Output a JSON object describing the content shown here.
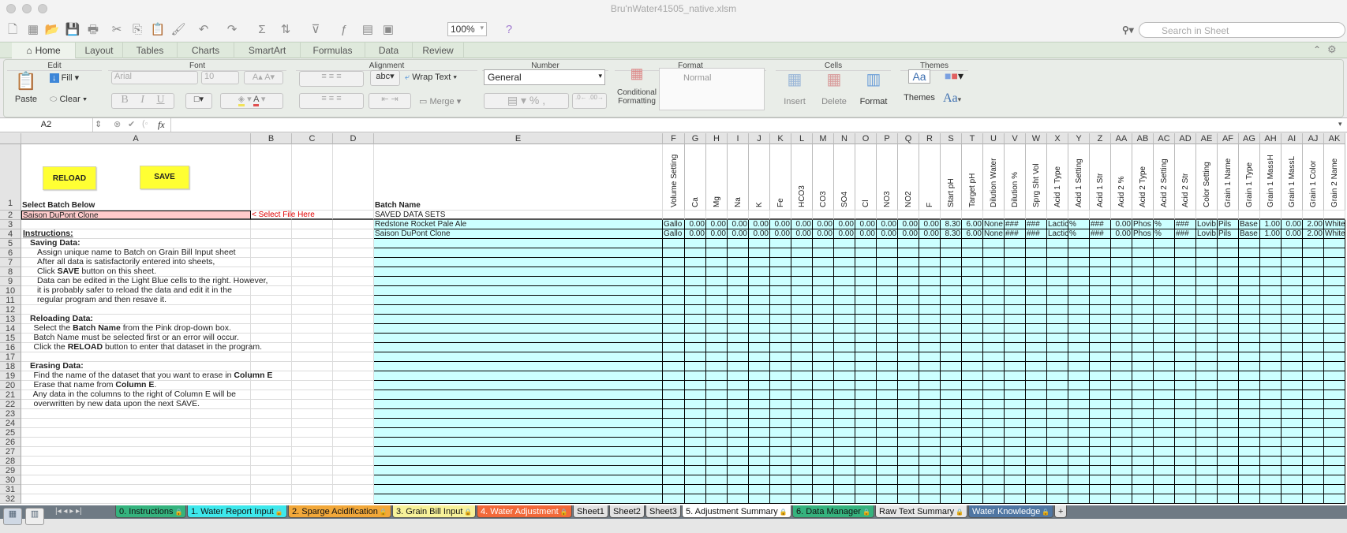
{
  "window": {
    "title": "Bru'nWater41505_native.xlsm"
  },
  "toolbar": {
    "icons": [
      "new-icon",
      "templates-icon",
      "open-icon",
      "save-icon",
      "print-icon",
      "cut-icon",
      "copy-icon",
      "paste-icon",
      "format-painter-icon",
      "undo-icon",
      "redo-icon",
      "autosum-icon",
      "sort-icon",
      "filter-icon",
      "function-icon",
      "gallery-icon",
      "media-icon"
    ],
    "zoom": "100%",
    "search_placeholder": "Search in Sheet"
  },
  "ribbon_tabs": [
    "Home",
    "Layout",
    "Tables",
    "Charts",
    "SmartArt",
    "Formulas",
    "Data",
    "Review"
  ],
  "ribbon": {
    "groups": {
      "edit": "Edit",
      "font": "Font",
      "alignment": "Alignment",
      "number": "Number",
      "format": "Format",
      "cells": "Cells",
      "themes": "Themes"
    },
    "paste": "Paste",
    "fill": "Fill",
    "clear": "Clear",
    "font_name": "Arial",
    "font_size": "10",
    "bold": "B",
    "italic": "I",
    "underline": "U",
    "abc": "abc",
    "wrap_text": "Wrap Text",
    "merge": "Merge",
    "number_format": "General",
    "percent": "%",
    "comma": ",",
    "conditional_formatting": "Conditional Formatting",
    "style_normal": "Normal",
    "insert": "Insert",
    "delete": "Delete",
    "format": "Format",
    "themes": "Themes",
    "aa": "Aa"
  },
  "formula_bar": {
    "name_box": "A2",
    "fx": "fx",
    "formula": ""
  },
  "sheet": {
    "column_letters": [
      "A",
      "B",
      "C",
      "D",
      "E",
      "F",
      "G",
      "H",
      "I",
      "J",
      "K",
      "L",
      "M",
      "N",
      "O",
      "P",
      "Q",
      "R",
      "S",
      "T",
      "U",
      "V",
      "W",
      "X",
      "Y",
      "Z",
      "AA",
      "AB",
      "AC",
      "AD",
      "AE",
      "AF",
      "AG",
      "AH",
      "AI",
      "AJ",
      "AK"
    ],
    "row_headers": [
      "1",
      "2",
      "3",
      "4",
      "5",
      "6",
      "7",
      "8",
      "9",
      "10",
      "11",
      "12",
      "13",
      "14",
      "15",
      "16",
      "17",
      "18",
      "19",
      "20",
      "21",
      "22",
      "23",
      "24",
      "25",
      "26",
      "27",
      "28",
      "29",
      "30",
      "31",
      "32"
    ],
    "reload_button": "RELOAD",
    "save_button": "SAVE",
    "a1": "Select Batch Below",
    "a2": "Saison DuPont Clone",
    "b2": "< Select File Here",
    "e1": "Batch Name",
    "e2": "SAVED DATA SETS",
    "field_headers": [
      "Volume Setting",
      "Ca",
      "Mg",
      "Na",
      "K",
      "Fe",
      "HCO3",
      "CO3",
      "SO4",
      "Cl",
      "NO3",
      "NO2",
      "F",
      "Start pH",
      "Target pH",
      "Dilution Water",
      "Dilution %",
      "Sprg Sht Vol",
      "Acid 1 Type",
      "Acid 1 Setting",
      "Acid 1 Str",
      "Acid 2 %",
      "Acid 2 Type",
      "Acid 2 Setting",
      "Acid 2 Str",
      "Color Setting",
      "Grain 1 Name",
      "Grain 1 Type",
      "Grain 1 MassH",
      "Grain 1 MassL",
      "Grain 1 Color",
      "Grain 2 Name"
    ],
    "datasets": [
      {
        "name": "Redstone Rocket Pale Ale",
        "values": [
          "Gallo",
          "0.00",
          "0.00",
          "0.00",
          "0.00",
          "0.00",
          "0.00",
          "0.00",
          "0.00",
          "0.00",
          "0.00",
          "0.00",
          "0.00",
          "8.30",
          "6.00",
          "None",
          "###",
          "###",
          "Lactic",
          "%",
          "###",
          "0.00",
          "Phos",
          "%",
          "###",
          "Lovib",
          "Pils",
          "Base",
          "1.00",
          "0.00",
          "2.00",
          "White"
        ]
      },
      {
        "name": "Saison DuPont Clone",
        "values": [
          "Gallo",
          "0.00",
          "0.00",
          "0.00",
          "0.00",
          "0.00",
          "0.00",
          "0.00",
          "0.00",
          "0.00",
          "0.00",
          "0.00",
          "0.00",
          "8.30",
          "6.00",
          "None",
          "###",
          "###",
          "Lactic",
          "%",
          "###",
          "0.00",
          "Phos",
          "%",
          "###",
          "Lovib",
          "Pils",
          "Base",
          "1.00",
          "0.00",
          "2.00",
          "White"
        ]
      }
    ],
    "instructions": [
      {
        "cell": "A4",
        "indent": 0,
        "u": true,
        "segs": [
          {
            "t": "Instructions:",
            "b": true
          }
        ]
      },
      {
        "cell": "A5",
        "indent": 1,
        "segs": [
          {
            "t": "Saving Data:",
            "b": true
          }
        ]
      },
      {
        "cell": "A6",
        "indent": 2,
        "segs": [
          {
            "t": "Assign unique name to Batch on Grain Bill Input sheet"
          }
        ]
      },
      {
        "cell": "A7",
        "indent": 2,
        "segs": [
          {
            "t": "After all data is satisfactorily entered into sheets,"
          }
        ]
      },
      {
        "cell": "A8",
        "indent": 2,
        "segs": [
          {
            "t": "Click "
          },
          {
            "t": "SAVE",
            "b": true
          },
          {
            "t": " button on this sheet."
          }
        ]
      },
      {
        "cell": "A9",
        "indent": 2,
        "segs": [
          {
            "t": "Data can be edited in the Light Blue cells to the right. However,"
          }
        ]
      },
      {
        "cell": "A10",
        "indent": 2,
        "segs": [
          {
            "t": "it is probably safer to reload the data and edit it in the"
          }
        ]
      },
      {
        "cell": "A11",
        "indent": 2,
        "segs": [
          {
            "t": "regular program and then resave it."
          }
        ]
      },
      {
        "cell": "A13",
        "indent": 1,
        "segs": [
          {
            "t": "Reloading Data:",
            "b": true
          }
        ]
      },
      {
        "cell": "A14",
        "indent": 1.5,
        "segs": [
          {
            "t": "Select the "
          },
          {
            "t": "Batch Name",
            "b": true
          },
          {
            "t": " from the Pink drop-down box."
          }
        ]
      },
      {
        "cell": "A15",
        "indent": 1.5,
        "segs": [
          {
            "t": "Batch Name must be selected first or an error will occur."
          }
        ]
      },
      {
        "cell": "A16",
        "indent": 1.5,
        "segs": [
          {
            "t": "Click the "
          },
          {
            "t": "RELOAD",
            "b": true
          },
          {
            "t": " button to enter that dataset in the program."
          }
        ]
      },
      {
        "cell": "A18",
        "indent": 1,
        "segs": [
          {
            "t": "Erasing Data:",
            "b": true
          }
        ]
      },
      {
        "cell": "A19",
        "indent": 1.5,
        "segs": [
          {
            "t": "Find the name of the dataset that you want to erase in "
          },
          {
            "t": "Column E",
            "b": true
          }
        ]
      },
      {
        "cell": "A20",
        "indent": 1.5,
        "segs": [
          {
            "t": "Erase that name from "
          },
          {
            "t": "Column E",
            "b": true
          },
          {
            "t": "."
          }
        ]
      },
      {
        "cell": "A21",
        "indent": 1.4,
        "segs": [
          {
            "t": "Any data in the columns to the right of Column E will be"
          }
        ]
      },
      {
        "cell": "A22",
        "indent": 1.5,
        "segs": [
          {
            "t": "overwritten by new data upon the next SAVE."
          }
        ]
      }
    ]
  },
  "sheet_tabs": [
    {
      "label": "0. Instructions",
      "color": "#35b37e",
      "text": "#111",
      "lock": true
    },
    {
      "label": "1. Water Report Input",
      "color": "#3ee8ec",
      "text": "#111",
      "lock": true
    },
    {
      "label": "2. Sparge Acidification",
      "color": "#f2a83a",
      "text": "#111",
      "lock": true
    },
    {
      "label": "3. Grain Bill Input",
      "color": "#f7f29a",
      "text": "#111",
      "lock": true
    },
    {
      "label": "4. Water Adjustment",
      "color": "#f2693a",
      "text": "#fff",
      "lock": true
    },
    {
      "label": "Sheet1",
      "color": "#e2e2e2",
      "text": "#111",
      "lock": false
    },
    {
      "label": "Sheet2",
      "color": "#e2e2e2",
      "text": "#111",
      "lock": false
    },
    {
      "label": "Sheet3",
      "color": "#e2e2e2",
      "text": "#111",
      "lock": false
    },
    {
      "label": "5. Adjustment Summary",
      "color": "#ffffff",
      "text": "#111",
      "lock": true
    },
    {
      "label": "6. Data Manager",
      "color": "#35b37e",
      "text": "#111",
      "lock": true
    },
    {
      "label": "Raw Text Summary",
      "color": "#e8e8e8",
      "text": "#111",
      "lock": true
    },
    {
      "label": "Water Knowledge",
      "color": "#4f76a3",
      "text": "#fff",
      "lock": true
    }
  ],
  "add_sheet": "+",
  "colors": {
    "pink_cell": "#ffcccc",
    "data_cell": "#ccffff",
    "button": "#ffff33",
    "link_red": "#e00000"
  }
}
